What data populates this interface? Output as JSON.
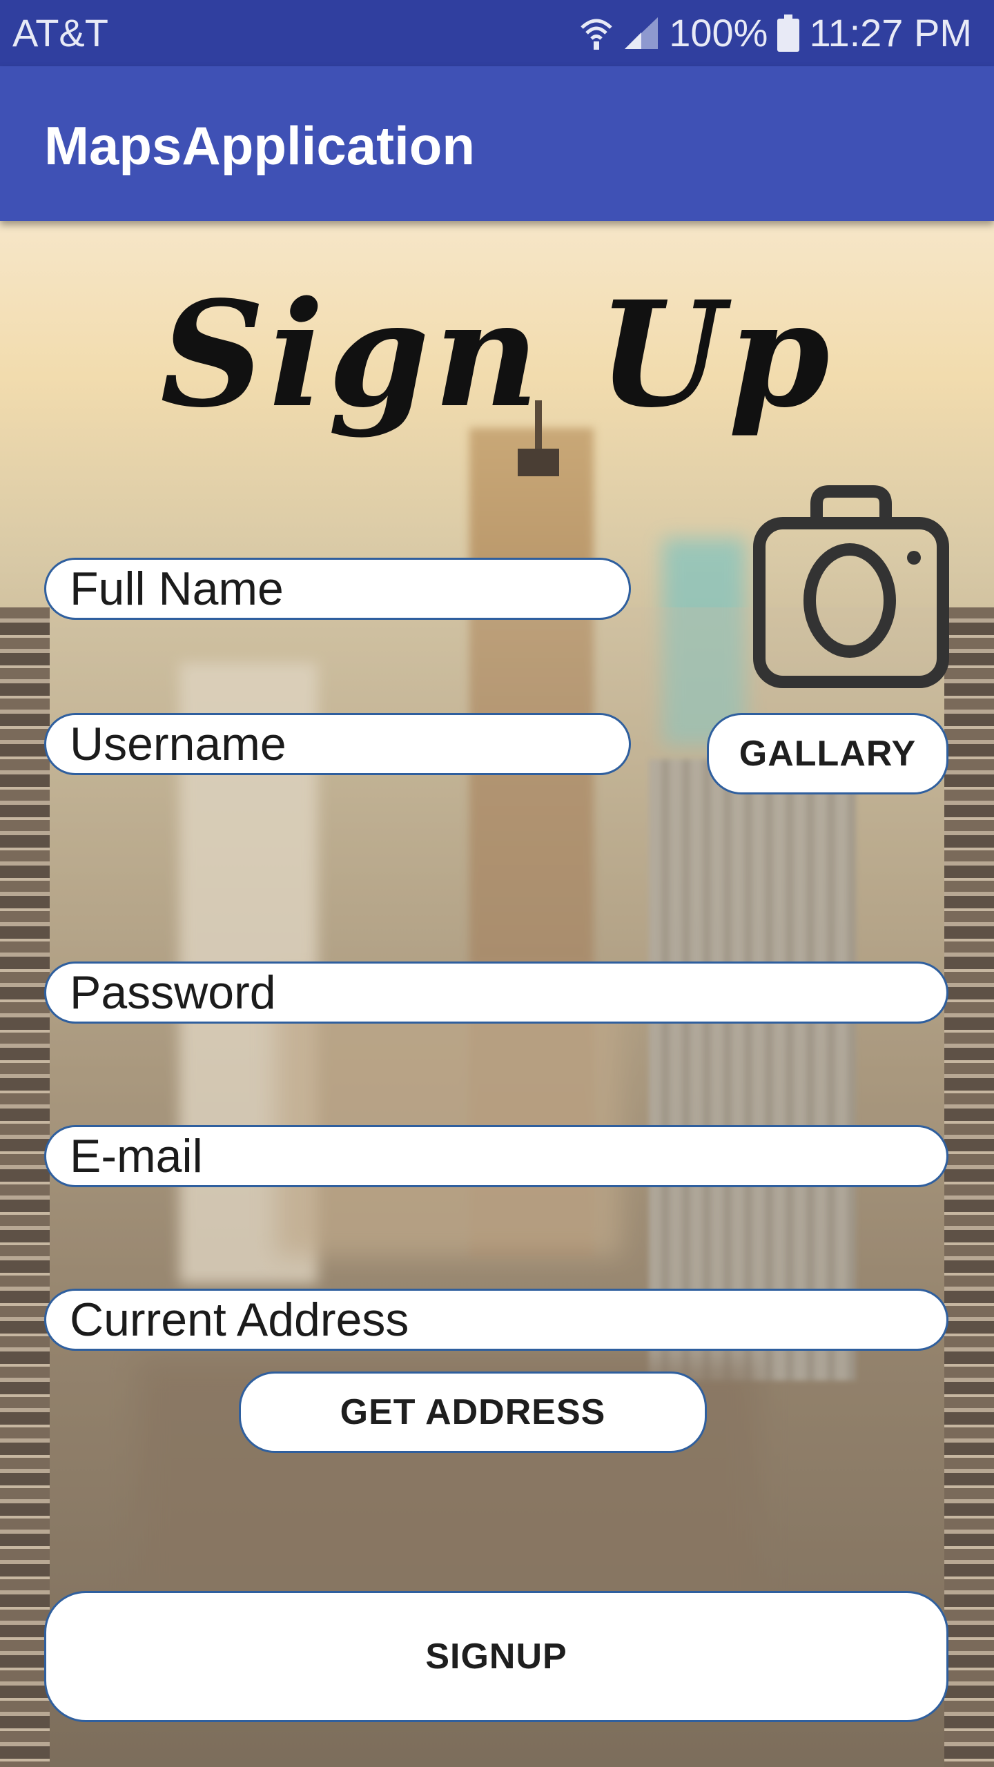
{
  "status_bar": {
    "carrier": "AT&T",
    "battery": "100%",
    "time": "11:27 PM",
    "icons": [
      "wifi-icon",
      "signal-icon",
      "battery-icon"
    ]
  },
  "app_bar": {
    "title": "MapsApplication"
  },
  "form": {
    "heading": "Sign Up",
    "camera_icon": "camera-icon",
    "full_name": {
      "placeholder": "Full Name",
      "value": ""
    },
    "username": {
      "placeholder": "Username",
      "value": ""
    },
    "password": {
      "placeholder": "Password",
      "value": ""
    },
    "email": {
      "placeholder": "E-mail",
      "value": ""
    },
    "address": {
      "placeholder": "Current Address",
      "value": ""
    },
    "gallary_button": "GALLARY",
    "get_address_button": "GET ADDRESS",
    "signup_button": "SIGNUP"
  },
  "colors": {
    "status_bar": "#303f9f",
    "app_bar": "#3f51b5",
    "field_border": "#2f5f9e"
  }
}
